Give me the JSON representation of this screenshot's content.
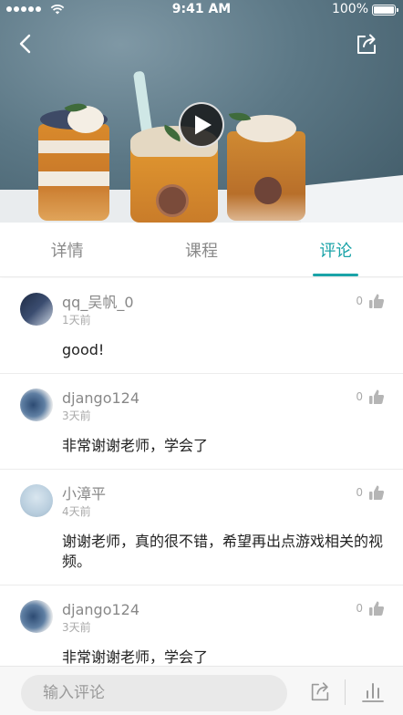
{
  "status_bar": {
    "time": "9:41 AM",
    "battery": "100%"
  },
  "hero": {
    "play_icon": "play-icon",
    "back_icon": "chevron-left-icon",
    "share_icon": "share-icon"
  },
  "tabs": [
    {
      "label": "详情",
      "active": false
    },
    {
      "label": "课程",
      "active": false
    },
    {
      "label": "评论",
      "active": true
    }
  ],
  "comments": [
    {
      "name": "qq_吴帆_0",
      "time": "1天前",
      "text": "good!",
      "likes": "0"
    },
    {
      "name": "django124",
      "time": "3天前",
      "text": "非常谢谢老师，学会了",
      "likes": "0"
    },
    {
      "name": "小漳平",
      "time": "4天前",
      "text": "谢谢老师，真的很不错，希望再出点游戏相关的视频。",
      "likes": "0"
    },
    {
      "name": "django124",
      "time": "3天前",
      "text": "非常谢谢老师，学会了",
      "likes": "0"
    }
  ],
  "bottom_bar": {
    "input_placeholder": "输入评论",
    "share_icon": "share-icon",
    "stats_icon": "bar-chart-icon"
  },
  "colors": {
    "accent": "#1aa3a8",
    "tab_inactive": "#8a8a8a"
  }
}
